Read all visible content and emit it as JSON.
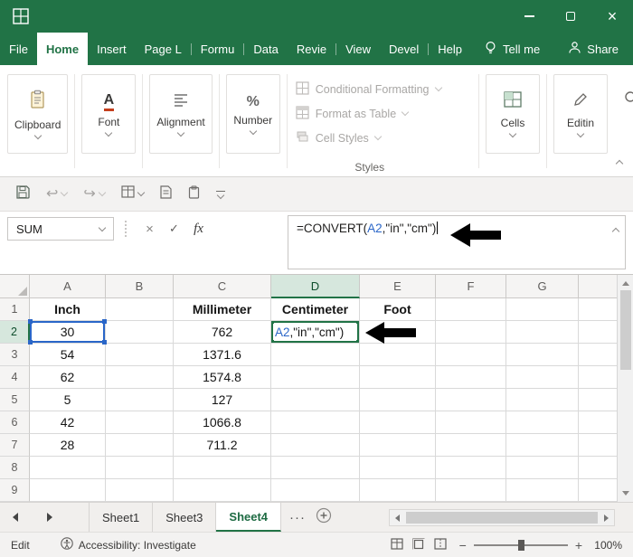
{
  "window": {
    "app": "Excel",
    "controls": {
      "minimize": "minimize",
      "maximize": "maximize",
      "close": "close"
    }
  },
  "ribbon_tabs": {
    "items": [
      {
        "label": "File",
        "active": false
      },
      {
        "label": "Home",
        "active": true
      },
      {
        "label": "Insert",
        "active": false
      },
      {
        "label": "Page L",
        "active": false
      },
      {
        "label": "Formu",
        "active": false
      },
      {
        "label": "Data",
        "active": false
      },
      {
        "label": "Revie",
        "active": false
      },
      {
        "label": "View",
        "active": false
      },
      {
        "label": "Devel",
        "active": false
      },
      {
        "label": "Help",
        "active": false
      }
    ],
    "tell_me": "Tell me",
    "share": "Share"
  },
  "ribbon": {
    "groups": [
      {
        "label": "Clipboard"
      },
      {
        "label": "Font"
      },
      {
        "label": "Alignment"
      },
      {
        "label": "Number"
      }
    ],
    "styles": {
      "items": [
        "Conditional Formatting",
        "Format as Table",
        "Cell Styles"
      ],
      "caption": "Styles"
    },
    "right_groups": [
      {
        "label": "Cells"
      },
      {
        "label": "Editin"
      }
    ]
  },
  "quick_access": {
    "undo_glyph": "↩",
    "redo_glyph": "↪"
  },
  "formula_bar": {
    "name_box": "SUM",
    "cancel_glyph": "×",
    "enter_glyph": "✓",
    "fx_label": "fx",
    "formula_prefix": "=CONVERT(",
    "formula_ref": "A2",
    "formula_suffix": ",\"in\",\"cm\")"
  },
  "sheet": {
    "col_headers": [
      "A",
      "B",
      "C",
      "D",
      "E",
      "F",
      "G"
    ],
    "selected_column": "D",
    "selected_row": "2",
    "row_headers": [
      "1",
      "2",
      "3",
      "4",
      "5",
      "6",
      "7",
      "8",
      "9"
    ],
    "cells": {
      "A1": "Inch",
      "C1": "Millimeter",
      "D1": "Centimeter",
      "E1": "Foot",
      "A2": "30",
      "C2": "762",
      "A3": "54",
      "C3": "1371.6",
      "A4": "62",
      "C4": "1574.8",
      "A5": "5",
      "C5": "127",
      "A6": "42",
      "C6": "1066.8",
      "A7": "28",
      "C7": "711.2",
      "D2_ref": "A2",
      "D2_rest": ",\"in\",\"cm\")"
    }
  },
  "sheet_tabs": {
    "items": [
      {
        "label": "Sheet1",
        "active": false
      },
      {
        "label": "Sheet3",
        "active": false
      },
      {
        "label": "Sheet4",
        "active": true
      }
    ],
    "more_glyph": "···"
  },
  "status_bar": {
    "mode": "Edit",
    "accessibility": "Accessibility: Investigate",
    "zoom_out_glyph": "−",
    "zoom_in_glyph": "+",
    "zoom_level": "100%"
  },
  "colors": {
    "excel_green": "#217346",
    "reference_blue": "#2a66c8",
    "edit_border_green": "#217346",
    "header_highlight": "#d6e7dd"
  },
  "icons": {
    "tell_me": "lightbulb",
    "share": "person-silhouette",
    "annotation": "solid-black-left-arrow",
    "name_box_dropdown": "chevron-down",
    "formula_bar_collapse": "chevron-up"
  }
}
